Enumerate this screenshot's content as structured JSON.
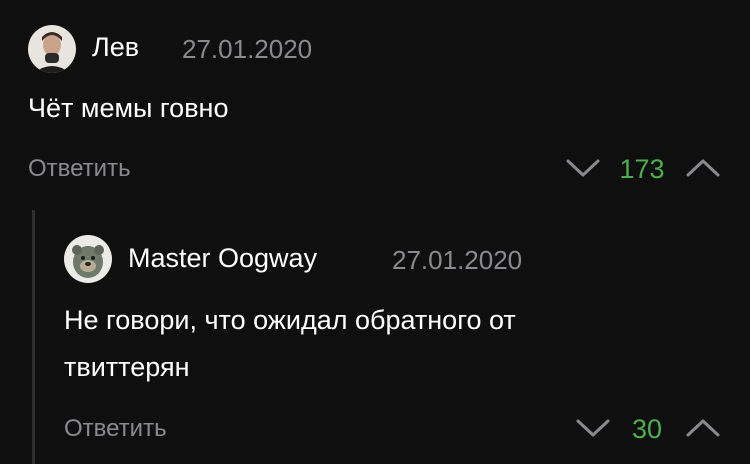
{
  "comment": {
    "author": "Лев",
    "date": "27.01.2020",
    "text": "Чёт мемы говно",
    "reply_label": "Ответить",
    "score": "173",
    "icons": {
      "avatar": "user-avatar-icon",
      "downvote": "chevron-down-icon",
      "upvote": "chevron-up-icon"
    }
  },
  "reply": {
    "author": "Master Oogway",
    "date": "27.01.2020",
    "text_line1": "Не говори, что ожидал обратного от",
    "text_line2": "твиттерян",
    "reply_label": "Ответить",
    "score": "30",
    "icons": {
      "avatar": "user-avatar-icon",
      "downvote": "chevron-down-icon",
      "upvote": "chevron-up-icon"
    }
  },
  "colors": {
    "background": "#0f0f10",
    "text": "#ffffff",
    "muted": "#8a8a8e",
    "score": "#4cae4f",
    "thread_line": "#2f2f33"
  }
}
